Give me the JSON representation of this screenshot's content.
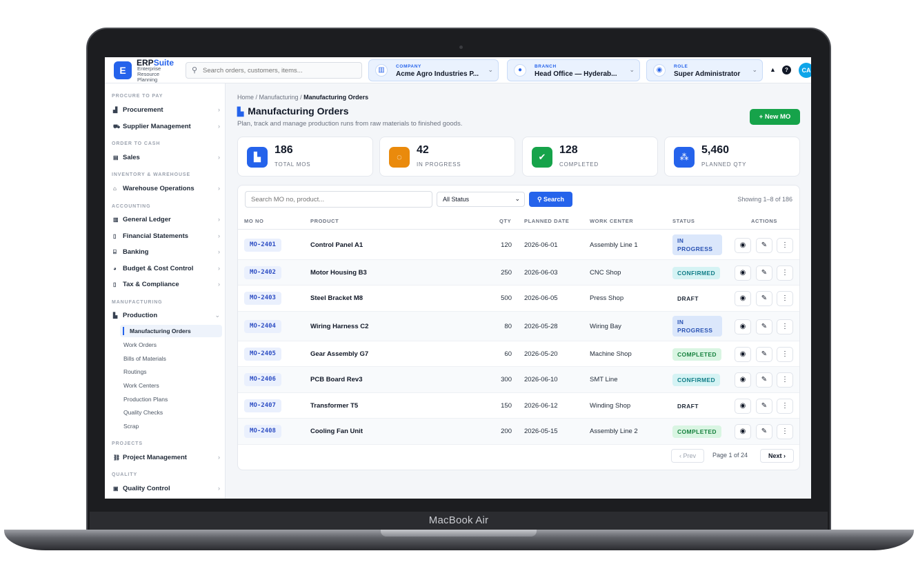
{
  "device": {
    "label": "MacBook Air"
  },
  "header": {
    "logo_letter": "E",
    "brand_main": "ERP",
    "brand_accent": "Suite",
    "brand_sub": "Enterprise Resource Planning",
    "search_placeholder": "Search orders, customers, items...",
    "company": {
      "label": "COMPANY",
      "value": "Acme Agro Industries P..."
    },
    "branch": {
      "label": "BRANCH",
      "value": "Head Office — Hyderab..."
    },
    "role": {
      "label": "ROLE",
      "value": "Super Administrator"
    },
    "avatar": "CA"
  },
  "sidebar": {
    "sections": {
      "procure": "PROCURE TO PAY",
      "order": "ORDER TO CASH",
      "inventory": "INVENTORY & WAREHOUSE",
      "accounting": "ACCOUNTING",
      "manufacturing": "MANUFACTURING",
      "projects": "PROJECTS",
      "quality": "QUALITY"
    },
    "items": {
      "procurement": "Procurement",
      "supplier": "Supplier Management",
      "sales": "Sales",
      "warehouse": "Warehouse Operations",
      "ledger": "General Ledger",
      "statements": "Financial Statements",
      "banking": "Banking",
      "budget": "Budget & Cost Control",
      "tax": "Tax & Compliance",
      "production": "Production",
      "projectmgmt": "Project Management",
      "qualitycontrol": "Quality Control"
    },
    "production_sub": [
      "Manufacturing Orders",
      "Work Orders",
      "Bills of Materials",
      "Routings",
      "Work Centers",
      "Production Plans",
      "Quality Checks",
      "Scrap"
    ]
  },
  "page": {
    "breadcrumb": [
      "Home",
      "Manufacturing",
      "Manufacturing Orders"
    ],
    "title": "Manufacturing Orders",
    "subtitle": "Plan, track and manage production runs from raw materials to finished goods.",
    "new_button": "+ New MO"
  },
  "stats": [
    {
      "value": "186",
      "label": "TOTAL MOS",
      "color": "#2563eb"
    },
    {
      "value": "42",
      "label": "IN PROGRESS",
      "color": "#ea8a0c"
    },
    {
      "value": "128",
      "label": "COMPLETED",
      "color": "#16a34a"
    },
    {
      "value": "5,460",
      "label": "PLANNED QTY",
      "color": "#2563eb"
    }
  ],
  "filters": {
    "search_placeholder": "Search MO no, product...",
    "status_value": "All Status",
    "search_button": "Search",
    "showing": "Showing 1–8 of 186"
  },
  "table": {
    "columns": [
      "MO NO",
      "PRODUCT",
      "QTY",
      "PLANNED DATE",
      "WORK CENTER",
      "STATUS",
      "ACTIONS"
    ],
    "rows": [
      {
        "mo": "MO-2401",
        "product": "Control Panel A1",
        "qty": "120",
        "date": "2026-06-01",
        "center": "Assembly Line 1",
        "status": "IN PROGRESS"
      },
      {
        "mo": "MO-2402",
        "product": "Motor Housing B3",
        "qty": "250",
        "date": "2026-06-03",
        "center": "CNC Shop",
        "status": "CONFIRMED"
      },
      {
        "mo": "MO-2403",
        "product": "Steel Bracket M8",
        "qty": "500",
        "date": "2026-06-05",
        "center": "Press Shop",
        "status": "DRAFT"
      },
      {
        "mo": "MO-2404",
        "product": "Wiring Harness C2",
        "qty": "80",
        "date": "2026-05-28",
        "center": "Wiring Bay",
        "status": "IN PROGRESS"
      },
      {
        "mo": "MO-2405",
        "product": "Gear Assembly G7",
        "qty": "60",
        "date": "2026-05-20",
        "center": "Machine Shop",
        "status": "COMPLETED"
      },
      {
        "mo": "MO-2406",
        "product": "PCB Board Rev3",
        "qty": "300",
        "date": "2026-06-10",
        "center": "SMT Line",
        "status": "CONFIRMED"
      },
      {
        "mo": "MO-2407",
        "product": "Transformer T5",
        "qty": "150",
        "date": "2026-06-12",
        "center": "Winding Shop",
        "status": "DRAFT"
      },
      {
        "mo": "MO-2408",
        "product": "Cooling Fan Unit",
        "qty": "200",
        "date": "2026-05-15",
        "center": "Assembly Line 2",
        "status": "COMPLETED"
      }
    ]
  },
  "pagination": {
    "prev": "‹ Prev",
    "page": "Page 1 of 24",
    "next": "Next ›"
  }
}
